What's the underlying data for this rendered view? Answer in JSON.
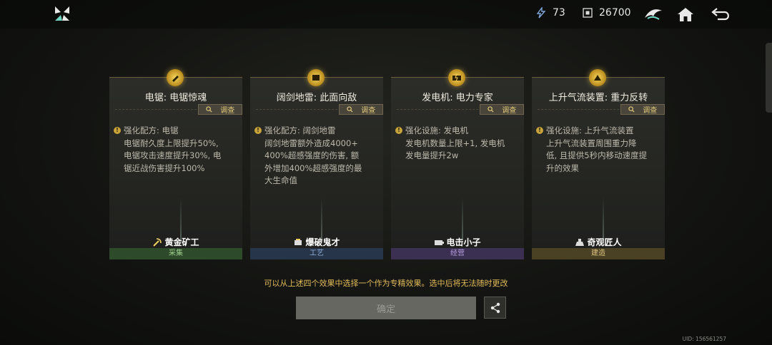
{
  "header": {
    "resources": [
      {
        "name": "energy",
        "value": "73"
      },
      {
        "name": "currency",
        "value": "26700"
      }
    ]
  },
  "cards": [
    {
      "title": "电锯: 电锯惊魂",
      "investigate_label": "调查",
      "lines": [
        "强化配方: 电锯",
        "电锯耐久度上限提升50%,",
        "电锯攻击速度提升30%, 电",
        "锯近战伤害提升100%"
      ],
      "trait": "黄金矿工",
      "category": "采集",
      "category_color": "#2d4a2a"
    },
    {
      "title": "阔剑地雷: 此面向敌",
      "investigate_label": "调查",
      "lines": [
        "强化配方: 阔剑地雷",
        "阔剑地雷额外造成4000+",
        "400%超感强度的伤害, 额",
        "外增加400%超感强度的最",
        "大生命值"
      ],
      "trait": "爆破鬼才",
      "category": "工艺",
      "category_color": "#26354a"
    },
    {
      "title": "发电机: 电力专家",
      "investigate_label": "调查",
      "lines": [
        "强化设施: 发电机",
        "发电机数量上限+1, 发电机",
        "发电量提升2w"
      ],
      "trait": "电击小子",
      "category": "经营",
      "category_color": "#3b2f52"
    },
    {
      "title": "上升气流装置: 重力反转",
      "investigate_label": "调查",
      "lines": [
        "强化设施: 上升气流装置",
        "上升气流装置周围重力降",
        "低, 且提供5秒内移动速度提",
        "升的效果"
      ],
      "trait": "奇观匠人",
      "category": "建造",
      "category_color": "#4a4024"
    }
  ],
  "notice": "可以从上述四个效果中选择一个作为专精效果。选中后将无法随时更改",
  "confirm_label": "确定",
  "uid": "UID: 156561257"
}
